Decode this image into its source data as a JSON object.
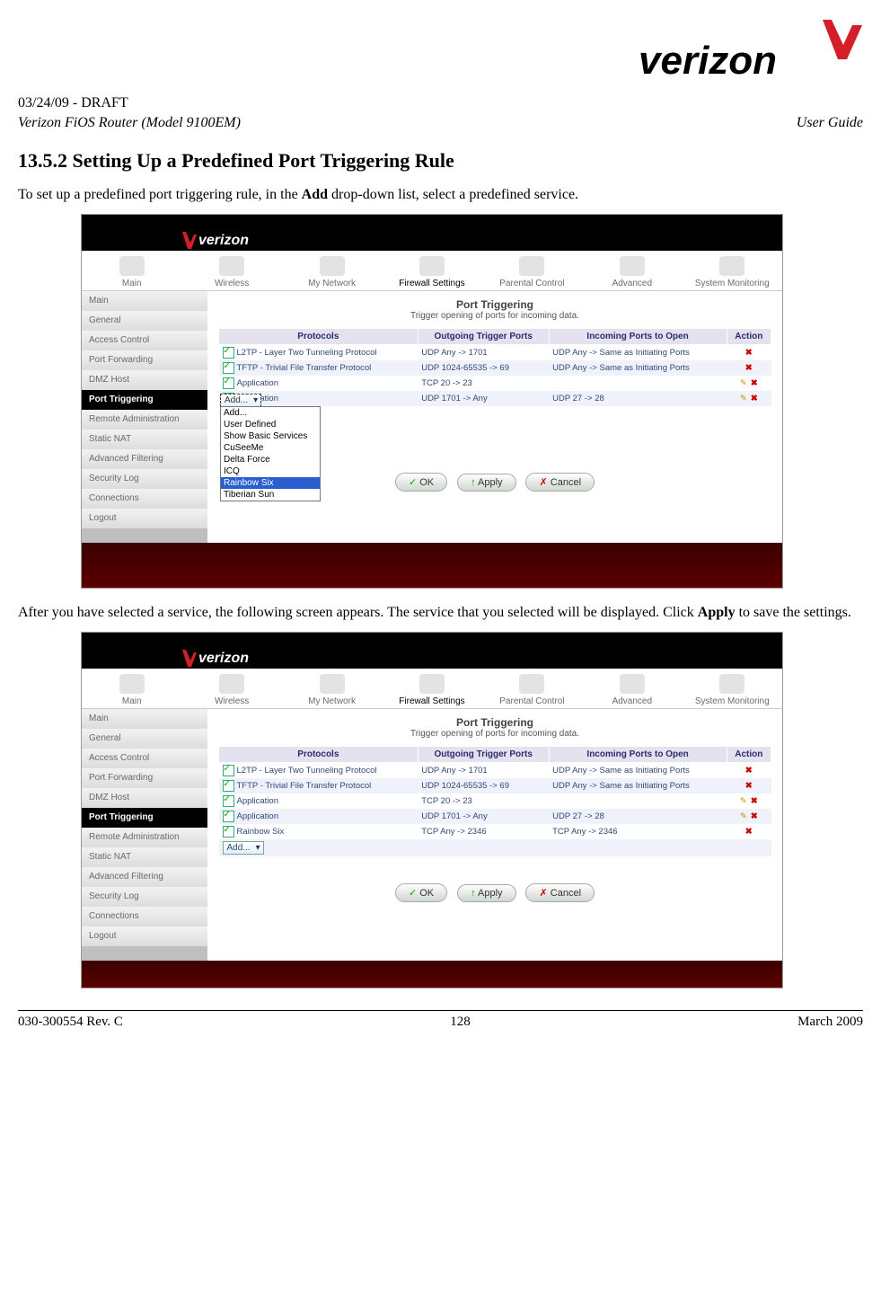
{
  "header": {
    "draft": "03/24/09 - DRAFT",
    "model": "Verizon FiOS Router (Model 9100EM)",
    "doc_type": "User Guide",
    "brand": "verizon"
  },
  "section": {
    "heading": "13.5.2 Setting Up a Predefined Port Triggering Rule",
    "para1_a": "To set up a predefined port triggering rule, in the ",
    "para1_b": "Add",
    "para1_c": " drop-down list, select a predefined service.",
    "para2_a": "After you have selected a service, the following screen appears. The service that you selected will be displayed. Click ",
    "para2_b": "Apply",
    "para2_c": " to save the settings."
  },
  "nav_items": [
    "Main",
    "Wireless",
    "My Network",
    "Firewall Settings",
    "Parental Control",
    "Advanced",
    "System Monitoring"
  ],
  "sidebar_items": [
    "Main",
    "General",
    "Access Control",
    "Port Forwarding",
    "DMZ Host",
    "Port Triggering",
    "Remote Administration",
    "Static NAT",
    "Advanced Filtering",
    "Security Log",
    "Connections",
    "Logout"
  ],
  "port_trigger": {
    "title": "Port Triggering",
    "subtitle": "Trigger opening of ports for incoming data.",
    "columns": [
      "Protocols",
      "Outgoing Trigger Ports",
      "Incoming Ports to Open",
      "Action"
    ],
    "add_label": "Add...",
    "rows_a": [
      {
        "proto": "L2TP - Layer Two Tunneling Protocol",
        "out": "UDP Any -> 1701",
        "in": "UDP Any -> Same as Initiating Ports",
        "edit": false
      },
      {
        "proto": "TFTP - Trivial File Transfer Protocol",
        "out": "UDP 1024-65535 -> 69",
        "in": "UDP Any -> Same as Initiating Ports",
        "edit": false
      },
      {
        "proto": "Application",
        "out": "TCP 20 -> 23",
        "in": "",
        "edit": true
      },
      {
        "proto": "Application",
        "out": "UDP 1701 -> Any",
        "in": "UDP 27 -> 28",
        "edit": true
      }
    ],
    "rows_b": [
      {
        "proto": "L2TP - Layer Two Tunneling Protocol",
        "out": "UDP Any -> 1701",
        "in": "UDP Any -> Same as Initiating Ports",
        "edit": false
      },
      {
        "proto": "TFTP - Trivial File Transfer Protocol",
        "out": "UDP 1024-65535 -> 69",
        "in": "UDP Any -> Same as Initiating Ports",
        "edit": false
      },
      {
        "proto": "Application",
        "out": "TCP 20 -> 23",
        "in": "",
        "edit": true
      },
      {
        "proto": "Application",
        "out": "UDP 1701 -> Any",
        "in": "UDP 27 -> 28",
        "edit": true
      },
      {
        "proto": "Rainbow Six",
        "out": "TCP Any -> 2346",
        "in": "TCP Any -> 2346",
        "edit": false
      }
    ],
    "dropdown_options": [
      "Add...",
      "User Defined",
      "Show Basic Services",
      "CuSeeMe",
      "Delta Force",
      "ICQ",
      "Rainbow Six",
      "Tiberian Sun"
    ]
  },
  "buttons": {
    "ok": "OK",
    "apply": "Apply",
    "cancel": "Cancel"
  },
  "footer": {
    "left": "030-300554 Rev. C",
    "center": "128",
    "right": "March 2009"
  }
}
